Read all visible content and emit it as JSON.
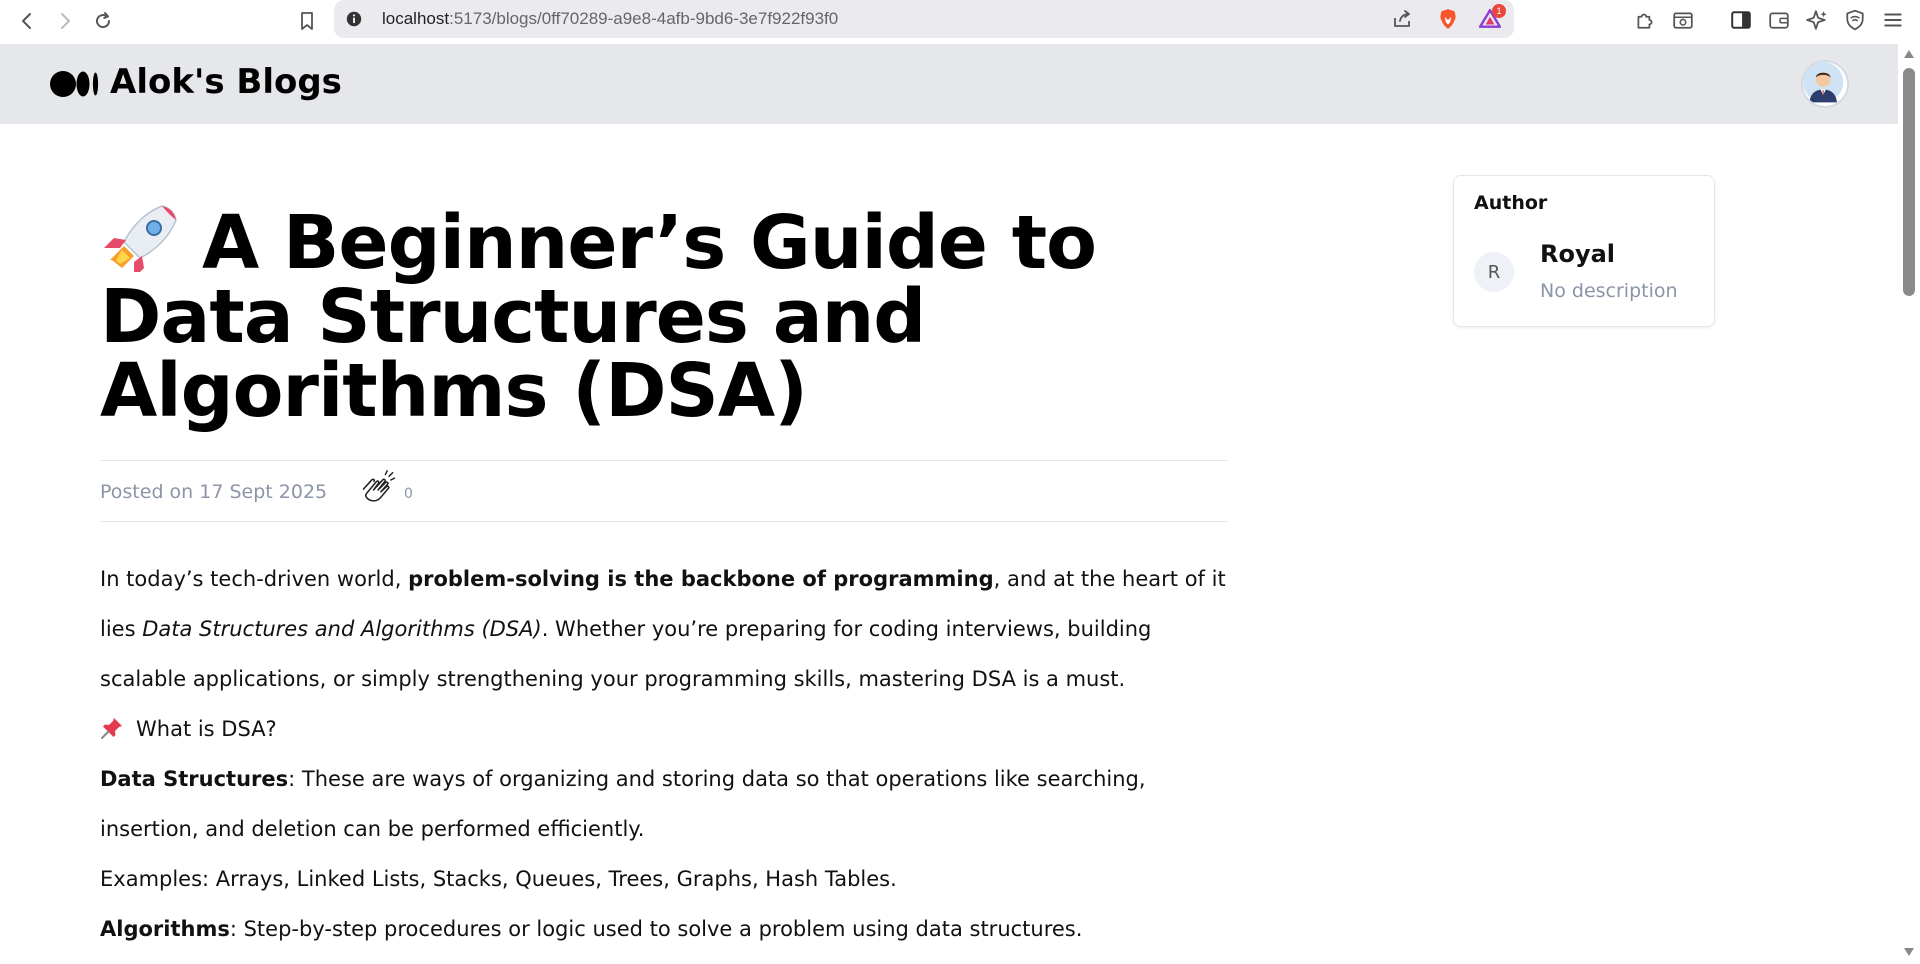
{
  "browser": {
    "url_host": "localhost",
    "url_path": ":5173/blogs/0ff70289-a9e8-4afb-9bd6-3e7f922f93f0",
    "notification_count": "1"
  },
  "site": {
    "title": "Alok's Blogs"
  },
  "article": {
    "title": "A Beginner’s Guide to Data Structures and Algorithms (DSA)",
    "posted_on": "Posted on 17 Sept 2025",
    "clap_count": "0",
    "p1_a": "In today’s tech-driven world, ",
    "p1_b": "problem-solving is the backbone of programming",
    "p1_c": ", and at the heart of it lies ",
    "p1_d": "Data Structures and Algorithms (DSA)",
    "p1_e": ". Whether you’re preparing for coding interviews, building scalable applications, or simply strengthening your programming skills, mastering DSA is a must.",
    "p2": "What is DSA?",
    "p3_a": "Data Structures",
    "p3_b": ": These are ways of organizing and storing data so that operations like searching, insertion, and deletion can be performed efficiently.",
    "p4": "Examples: Arrays, Linked Lists, Stacks, Queues, Trees, Graphs, Hash Tables.",
    "p5_a": "Algorithms",
    "p5_b": ": Step-by-step procedures or logic used to solve a problem using data structures."
  },
  "author_card": {
    "heading": "Author",
    "avatar_initial": "R",
    "name": "Royal",
    "description": "No description"
  },
  "icons": {
    "back": "back-arrow-icon",
    "forward": "forward-arrow-icon",
    "reload": "reload-icon",
    "bookmark": "bookmark-icon",
    "site_info": "info-icon",
    "share": "share-icon",
    "brave": "brave-shield-icon",
    "rewards": "brave-rewards-icon",
    "extensions": "extensions-icon",
    "screenshot": "page-capture-icon",
    "sidebar": "sidebar-icon",
    "wallet": "wallet-icon",
    "leo": "leo-ai-icon",
    "vpn": "vpn-icon",
    "menu": "menu-icon",
    "logo": "medium-logo-icon",
    "clap": "clap-icon",
    "rocket": "rocket-icon",
    "pin": "pushpin-icon"
  },
  "colors": {
    "header_bg": "#e5e7eb",
    "muted_text": "#8b95a7",
    "brave_orange": "#fb542b"
  }
}
